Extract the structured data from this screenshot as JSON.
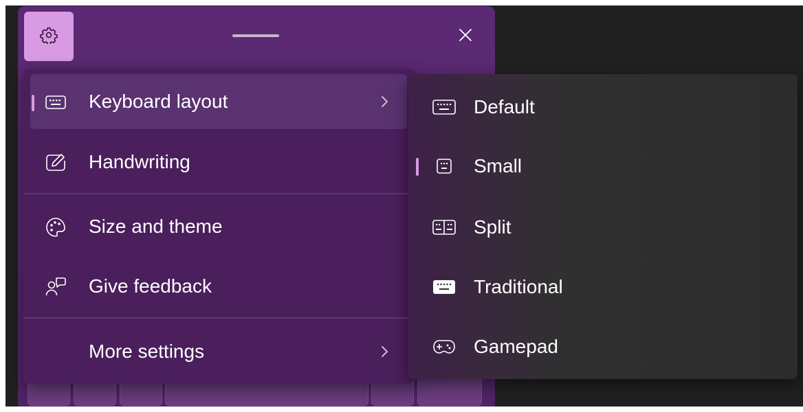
{
  "colors": {
    "accent": "#d99ae3",
    "window_bg": "#5c2a74",
    "menu_bg": "#4a1f5c",
    "submenu_bg": "#2c2c2c",
    "desktop_bg": "#202020"
  },
  "titlebar": {
    "settings_icon": "gear-icon",
    "close_icon": "close-icon"
  },
  "menu": {
    "items": [
      {
        "label": "Keyboard layout",
        "icon": "keyboard-icon",
        "has_submenu": true,
        "selected": true
      },
      {
        "label": "Handwriting",
        "icon": "pen-icon",
        "has_submenu": false,
        "selected": false
      },
      {
        "label": "Size and theme",
        "icon": "palette-icon",
        "has_submenu": false,
        "selected": false
      },
      {
        "label": "Give feedback",
        "icon": "feedback-icon",
        "has_submenu": false,
        "selected": false
      },
      {
        "label": "More settings",
        "icon": "",
        "has_submenu": true,
        "selected": false
      }
    ]
  },
  "submenu": {
    "items": [
      {
        "label": "Default",
        "icon": "keyboard-default-icon",
        "selected": false
      },
      {
        "label": "Small",
        "icon": "keyboard-small-icon",
        "selected": true
      },
      {
        "label": "Split",
        "icon": "keyboard-split-icon",
        "selected": false
      },
      {
        "label": "Traditional",
        "icon": "keyboard-traditional-icon",
        "selected": false
      },
      {
        "label": "Gamepad",
        "icon": "gamepad-icon",
        "selected": false
      }
    ]
  }
}
